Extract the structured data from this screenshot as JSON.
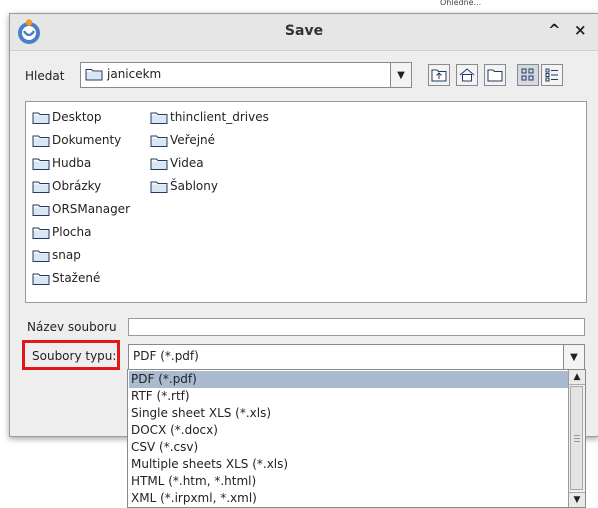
{
  "background": {
    "clipped_text": "Ohledně..."
  },
  "dialog": {
    "title": "Save",
    "buttons": {
      "maximize": "^",
      "close": "×"
    }
  },
  "look_in": {
    "label": "Hledat",
    "folder": "janicekm",
    "tools": [
      "up-folder-icon",
      "home-icon",
      "new-folder-icon",
      "list-view-icon",
      "details-view-icon"
    ]
  },
  "files": {
    "column1": [
      "Desktop",
      "Dokumenty",
      "Hudba",
      "Obrázky",
      "ORSManager",
      "Plocha",
      "snap",
      "Stažené"
    ],
    "column2": [
      "thinclient_drives",
      "Veřejné",
      "Videa",
      "Šablony"
    ]
  },
  "file_name": {
    "label": "Název souboru",
    "value": ""
  },
  "file_type": {
    "label": "Soubory typu:",
    "selected": "PDF (*.pdf)",
    "options": [
      "PDF (*.pdf)",
      "RTF (*.rtf)",
      "Single sheet XLS (*.xls)",
      "DOCX (*.docx)",
      "CSV (*.csv)",
      "Multiple sheets XLS (*.xls)",
      "HTML (*.htm, *.html)",
      "XML (*.irpxml, *.xml)"
    ]
  },
  "colors": {
    "highlight": "#e21818",
    "selection": "#aabbd0"
  }
}
